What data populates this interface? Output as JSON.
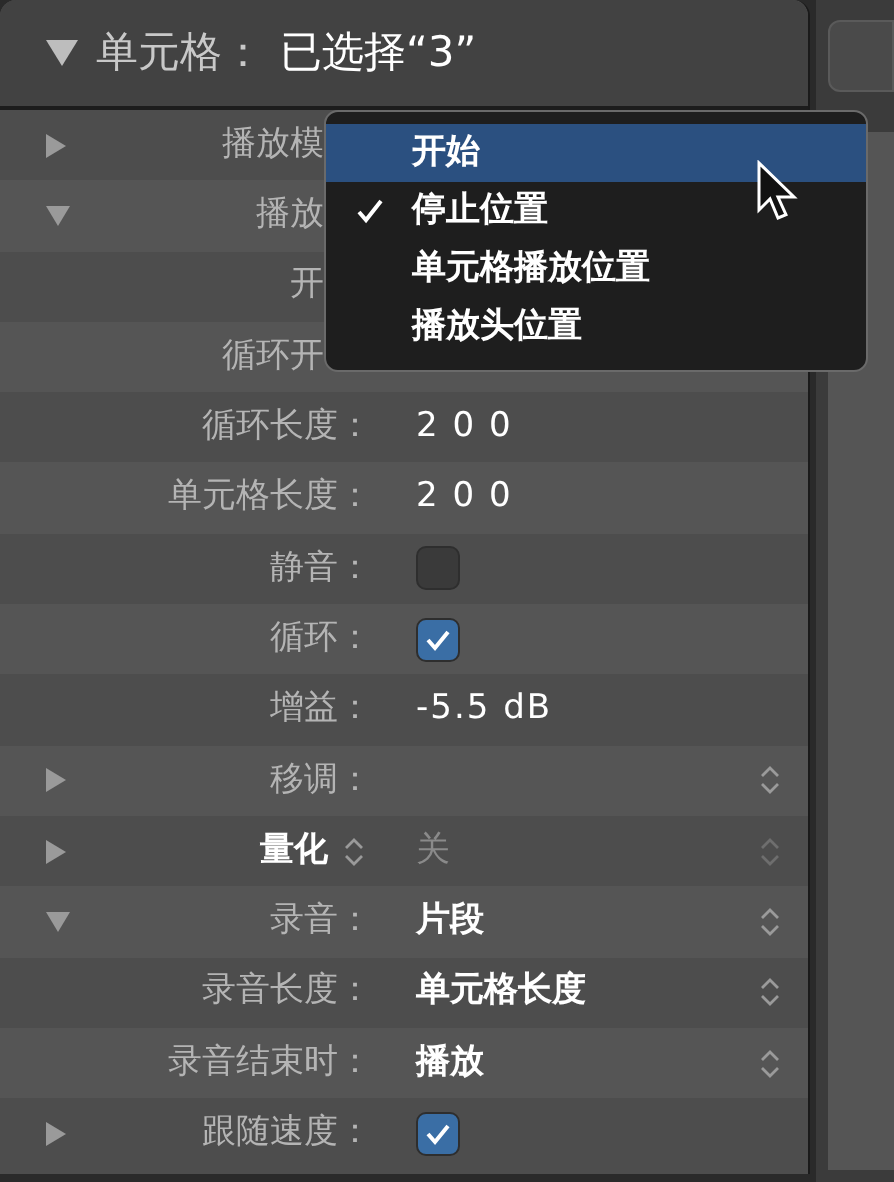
{
  "header": {
    "expanded": true,
    "label": "单元格：",
    "value": "已选择“3”"
  },
  "rows": [
    {
      "kind": "covered",
      "expanded": false,
      "label": "播放模"
    },
    {
      "kind": "covered",
      "expanded": true,
      "label": "播放"
    },
    {
      "kind": "covered",
      "label": "开"
    },
    {
      "kind": "covered",
      "label": "循环开"
    },
    {
      "kind": "text",
      "label": "循环长度：",
      "value": "2 0 0"
    },
    {
      "kind": "text",
      "label": "单元格长度：",
      "value": "2 0 0"
    },
    {
      "kind": "checkbox",
      "label": "静音：",
      "checked": false
    },
    {
      "kind": "checkbox",
      "label": "循环：",
      "checked": true
    },
    {
      "kind": "text",
      "label": "增益：",
      "value": "-5.5 dB"
    },
    {
      "kind": "popup",
      "expanded": false,
      "label": "移调：",
      "disabled": false
    },
    {
      "kind": "mode",
      "expanded": false,
      "label": "量化",
      "value": "关",
      "disabled": true
    },
    {
      "kind": "popup",
      "expanded": true,
      "label": "录音：",
      "value": "片段",
      "disabled": false
    },
    {
      "kind": "popup",
      "label": "录音长度：",
      "value": "单元格长度",
      "disabled": false
    },
    {
      "kind": "popup",
      "label": "录音结束时：",
      "value": "播放",
      "disabled": false
    },
    {
      "kind": "checkbox",
      "expanded": false,
      "label": "跟随速度：",
      "checked": true
    }
  ],
  "menu": [
    {
      "label": "开始",
      "selected": true,
      "checked": false
    },
    {
      "label": "停止位置",
      "selected": false,
      "checked": true
    },
    {
      "label": "单元格播放位置",
      "selected": false,
      "checked": false
    },
    {
      "label": "播放头位置",
      "selected": false,
      "checked": false
    }
  ]
}
